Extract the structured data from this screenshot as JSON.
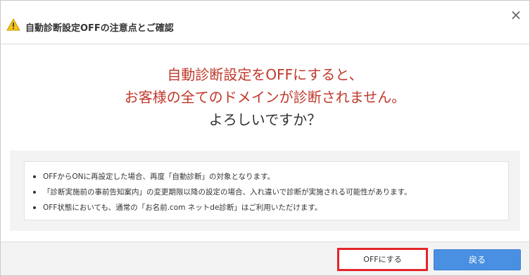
{
  "dialog": {
    "title": "自動診断設定OFFの注意点とご確認",
    "close_symbol": "×",
    "warning_icon": "warning-icon",
    "colors": {
      "alert_text": "#c0392b",
      "primary_button": "#4a90e2",
      "highlight_border": "#e3262a"
    }
  },
  "message": {
    "line1": "自動診断設定をOFFにすると、",
    "line2": "お客様の全てのドメインが診断されません。",
    "line3": "よろしいですか？"
  },
  "notes": [
    "OFFからONに再設定した場合、再度「自動診断」の対象となります。",
    "「診断実施前の事前告知案内」の変更期限以降の設定の場合、入れ違いで診断が実施される可能性があります。",
    "OFF状態においても、通常の「お名前.com ネットde診断」はご利用いただけます。"
  ],
  "footer": {
    "off_button": "OFFにする",
    "back_button": "戻る"
  }
}
